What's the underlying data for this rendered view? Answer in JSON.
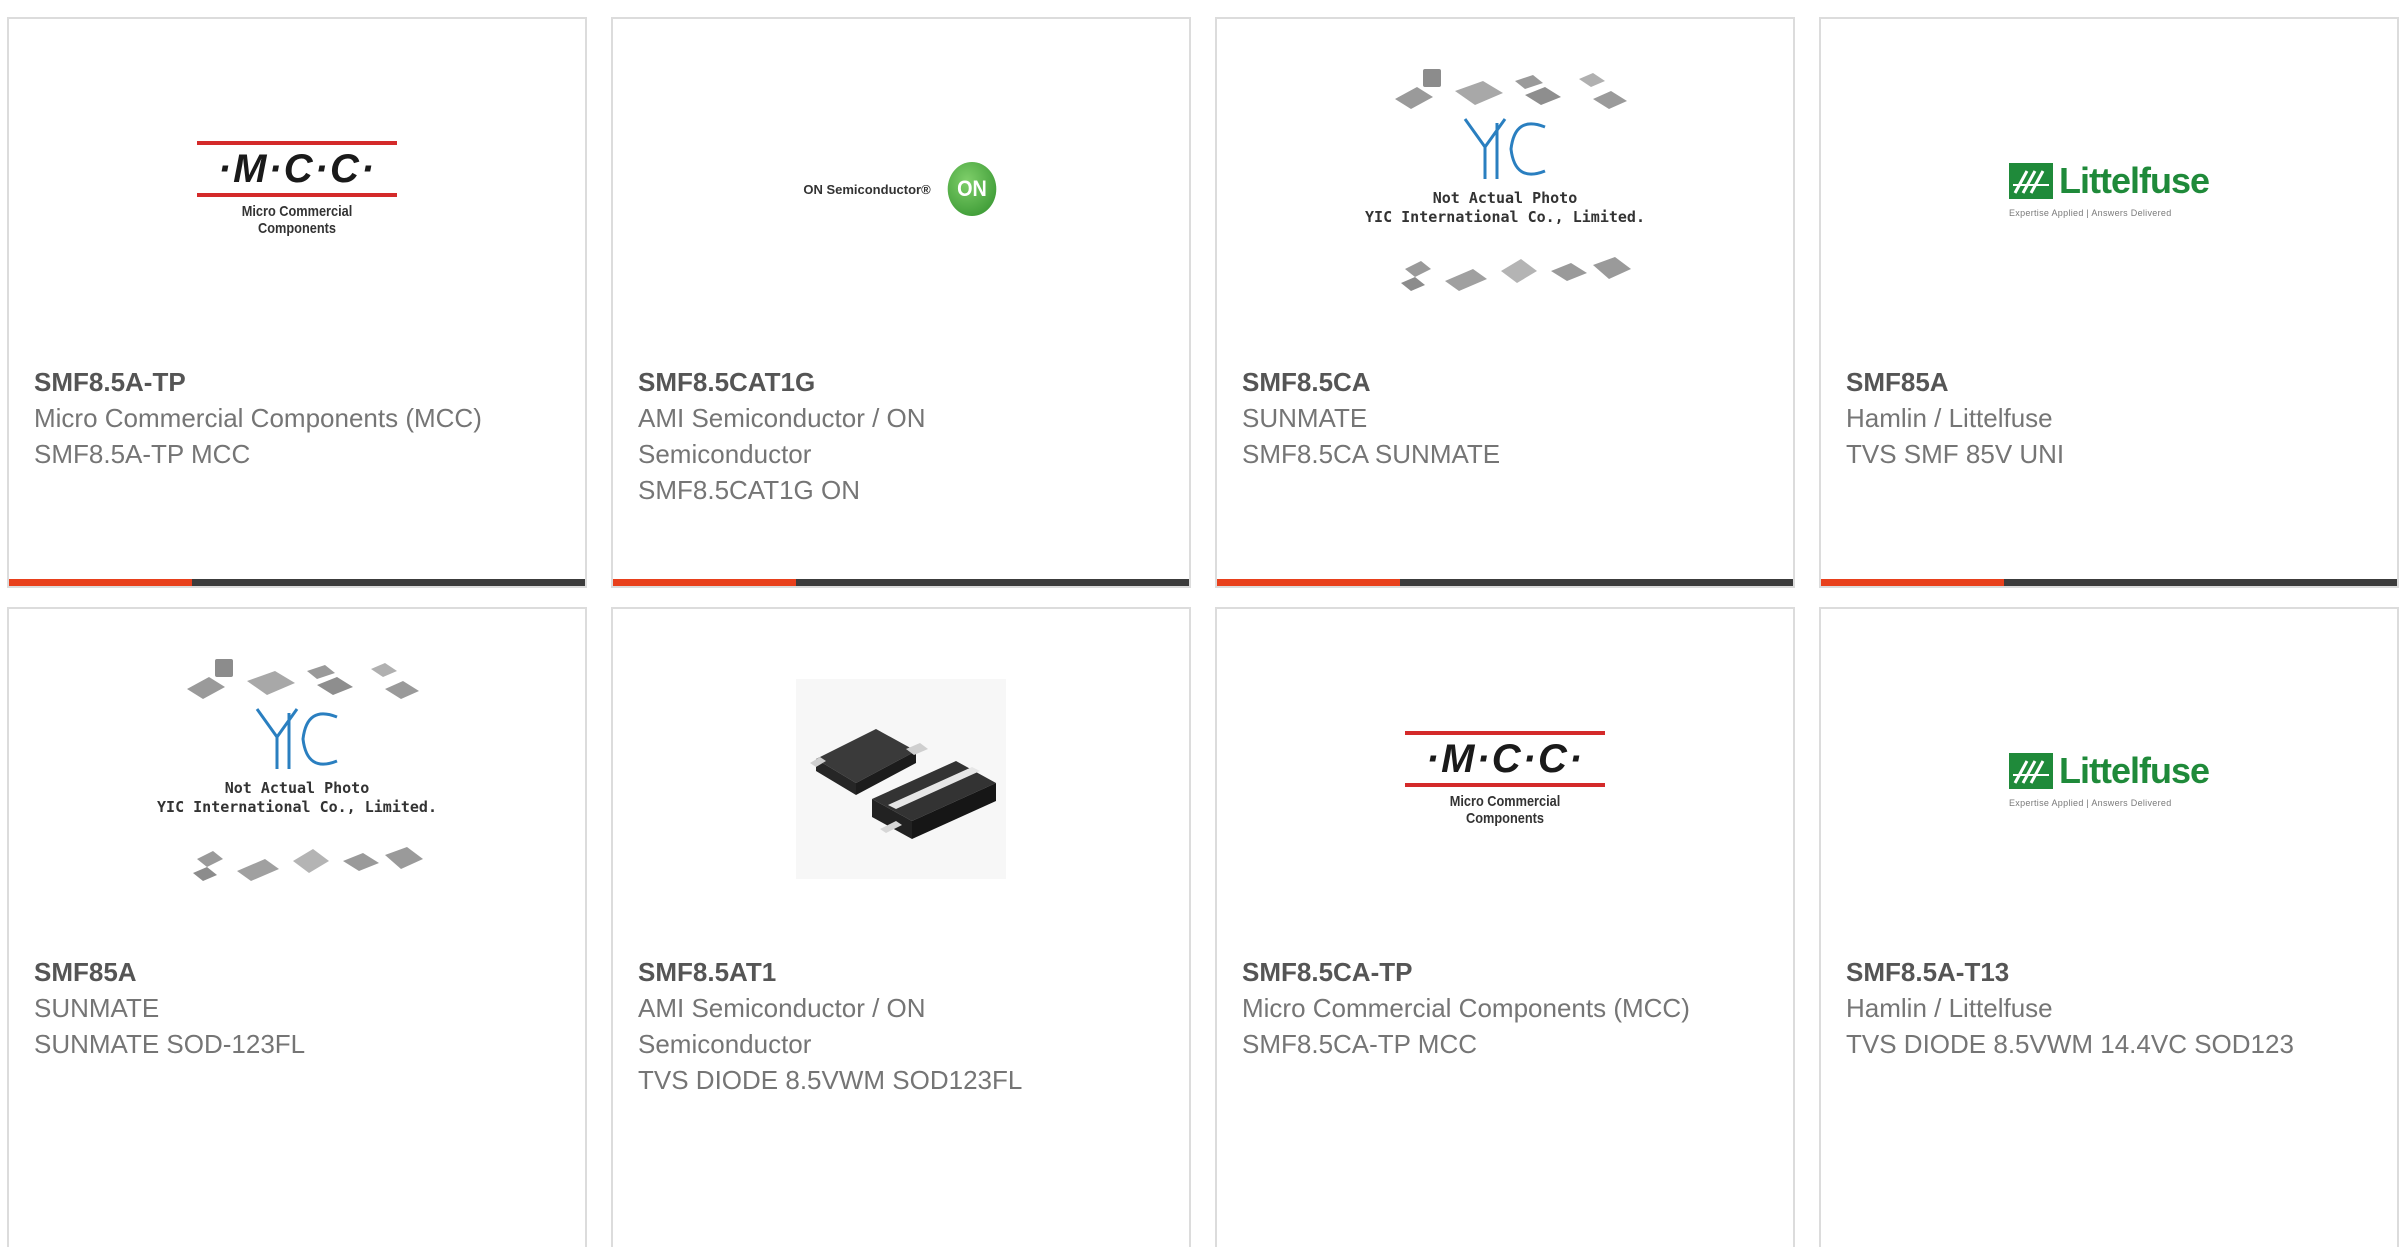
{
  "products": [
    {
      "part": "SMF8.5A-TP",
      "manufacturer": "Micro Commercial Components (MCC)",
      "description": "SMF8.5A-TP MCC",
      "logo": "mcc-logo"
    },
    {
      "part": "SMF8.5CAT1G",
      "manufacturer": "AMI Semiconductor / ON Semiconductor",
      "description": "SMF8.5CAT1G ON",
      "logo": "on-semiconductor-logo"
    },
    {
      "part": "SMF8.5CA",
      "manufacturer": "SUNMATE",
      "description": "SMF8.5CA SUNMATE",
      "logo": "yic-placeholder"
    },
    {
      "part": "SMF85A",
      "manufacturer": "Hamlin / Littelfuse",
      "description": "TVS SMF 85V UNI",
      "logo": "littelfuse-logo"
    },
    {
      "part": "SMF85A",
      "manufacturer": "SUNMATE",
      "description": "SUNMATE SOD-123FL",
      "logo": "yic-placeholder"
    },
    {
      "part": "SMF8.5AT1",
      "manufacturer": "AMI Semiconductor / ON Semiconductor",
      "description": "TVS DIODE 8.5VWM SOD123FL",
      "logo": "diode-photo"
    },
    {
      "part": "SMF8.5CA-TP",
      "manufacturer": "Micro Commercial Components (MCC)",
      "description": "SMF8.5CA-TP MCC",
      "logo": "mcc-logo"
    },
    {
      "part": "SMF8.5A-T13",
      "manufacturer": "Hamlin / Littelfuse",
      "description": "TVS DIODE 8.5VWM 14.4VC SOD123",
      "logo": "littelfuse-logo"
    }
  ],
  "logos": {
    "mcc": {
      "word": "·M·C·C·",
      "sub": "Micro Commercial Components",
      "tm": "™"
    },
    "on": {
      "text": "ON Semiconductor®",
      "mark": "ON"
    },
    "littelfuse": {
      "name": "Littelfuse",
      "tagline": "Expertise Applied | Answers Delivered"
    },
    "yic": {
      "line1": "Not Actual Photo",
      "line2": "YIC International Co., Limited."
    }
  },
  "colors": {
    "accent": "#e8401c",
    "bar": "#3c3c3c",
    "border": "#dcdcdc",
    "littelfuse_green": "#1f8a3a",
    "mcc_red": "#d42a2a"
  }
}
